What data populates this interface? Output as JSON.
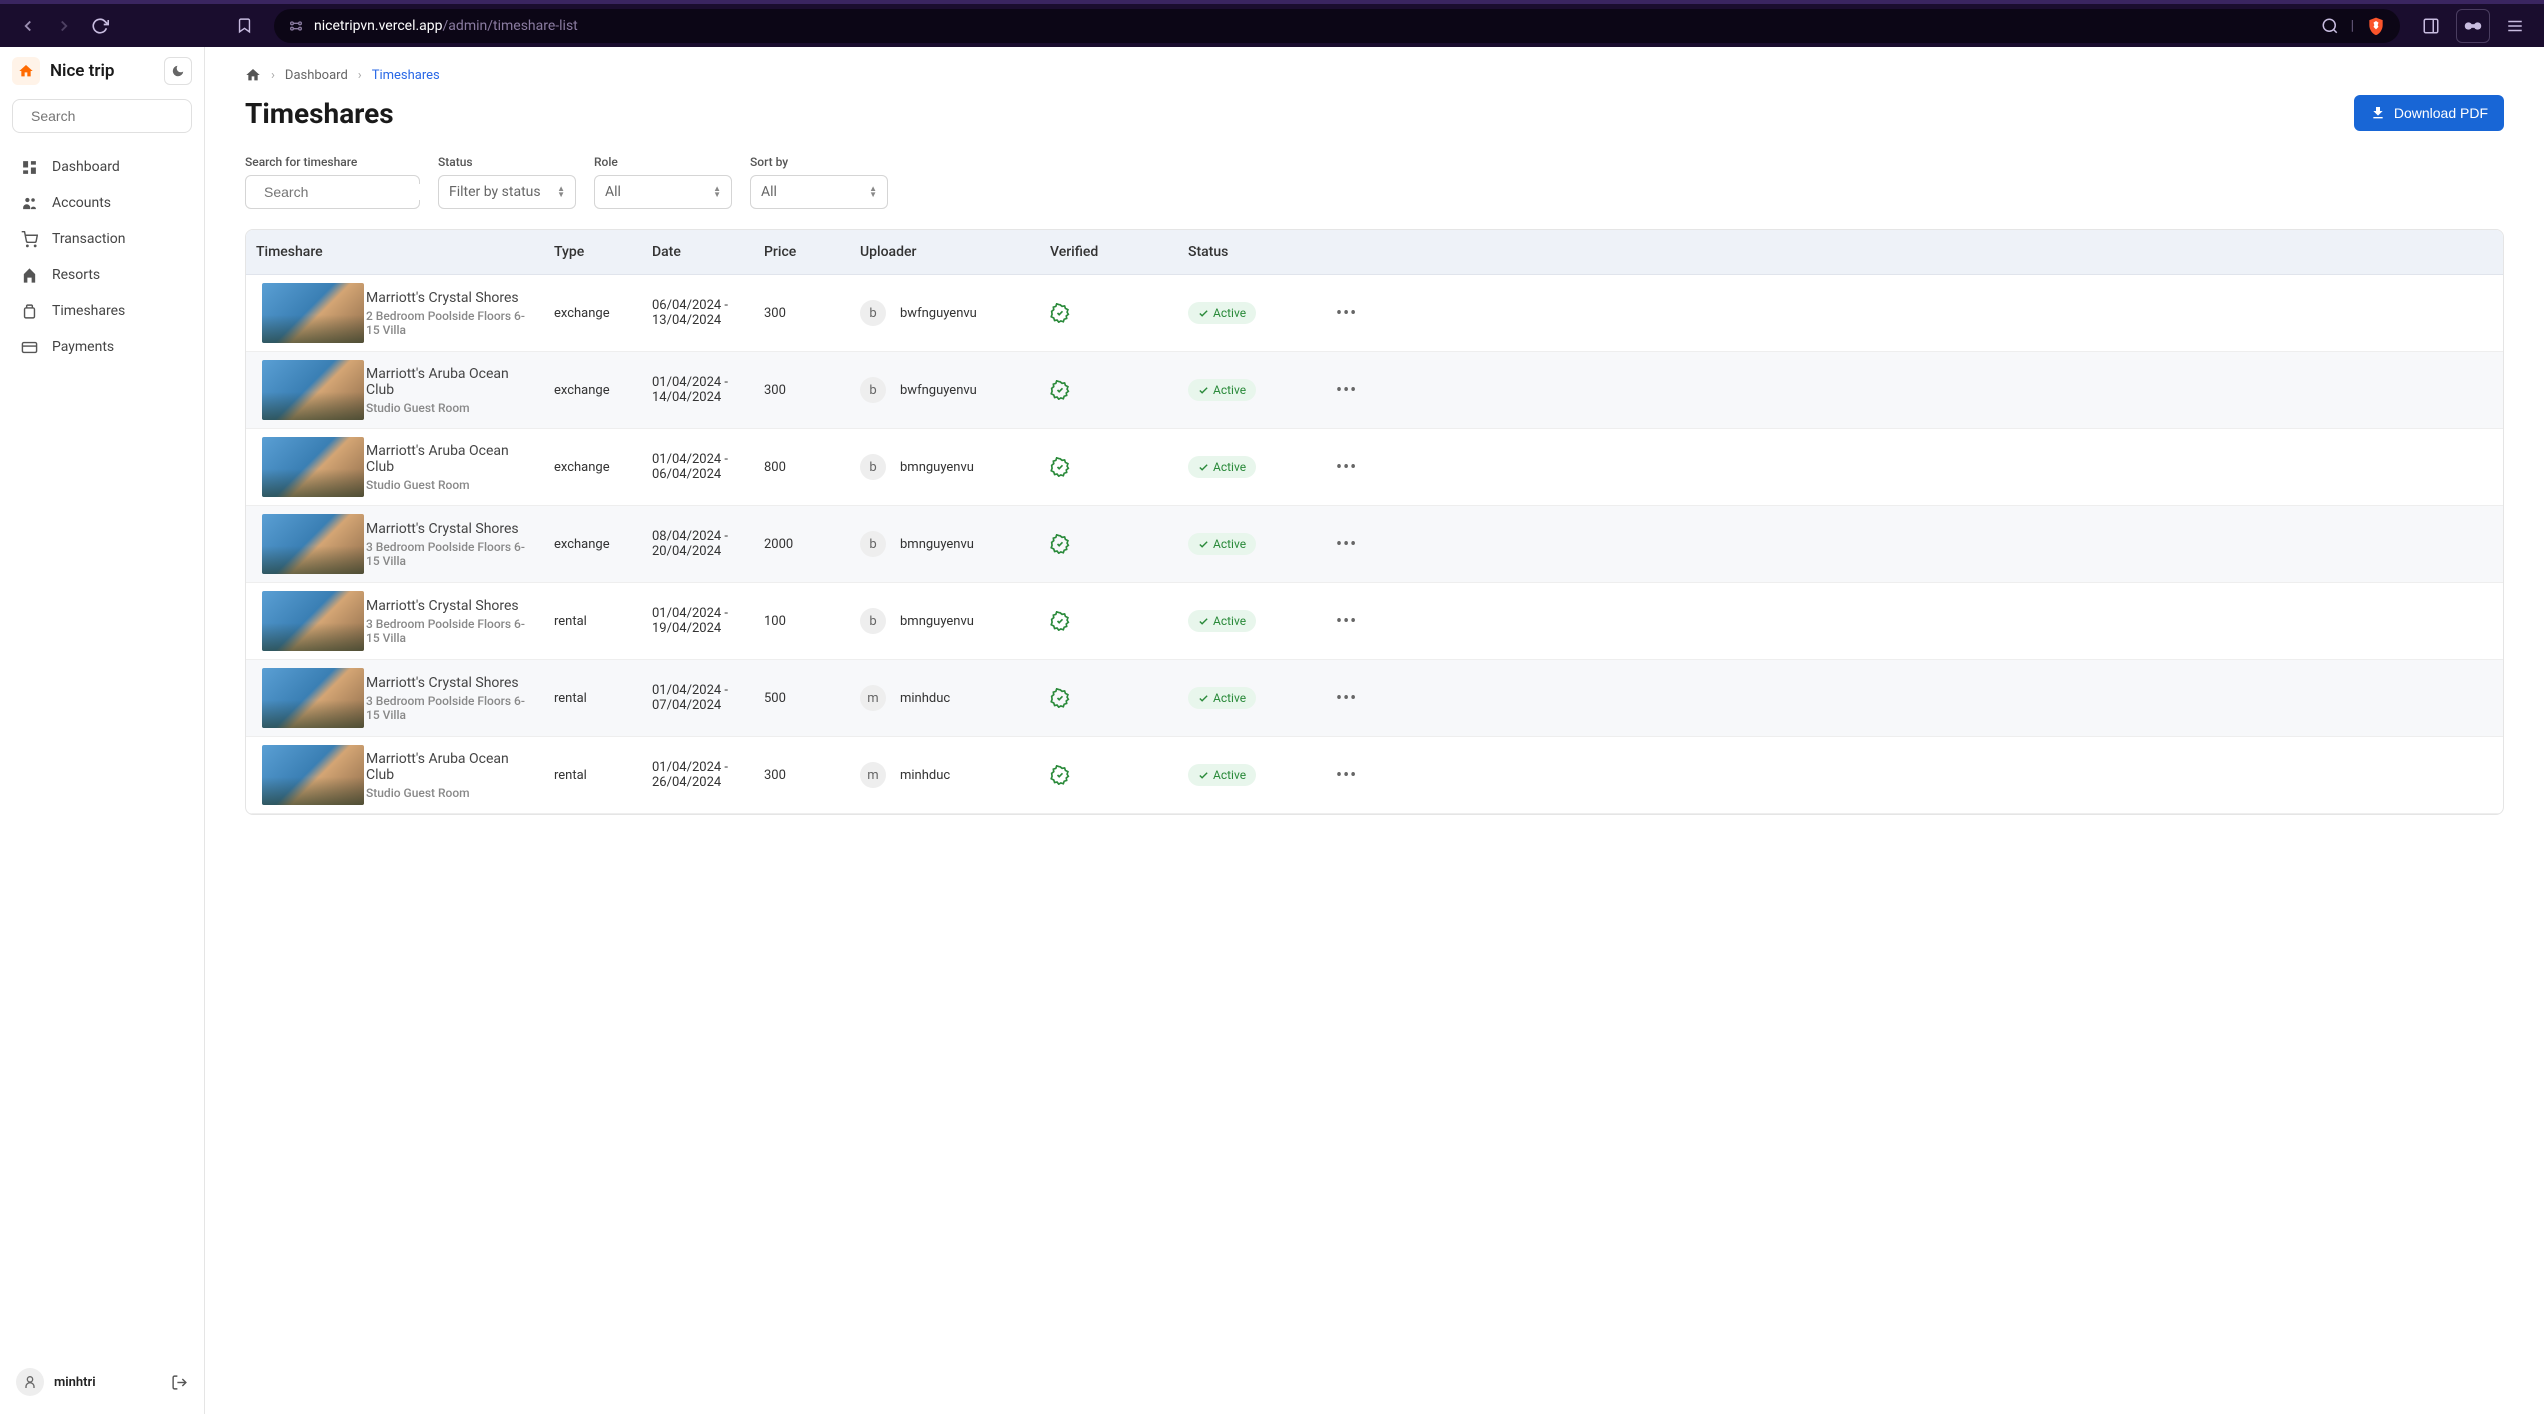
{
  "browser": {
    "url_host": "nicetripvn.vercel.app",
    "url_path": "/admin/timeshare-list"
  },
  "sidebar": {
    "brand": "Nice trip",
    "search_placeholder": "Search",
    "items": [
      {
        "icon": "dashboard",
        "label": "Dashboard"
      },
      {
        "icon": "accounts",
        "label": "Accounts"
      },
      {
        "icon": "transaction",
        "label": "Transaction"
      },
      {
        "icon": "resorts",
        "label": "Resorts"
      },
      {
        "icon": "timeshares",
        "label": "Timeshares"
      },
      {
        "icon": "payments",
        "label": "Payments"
      }
    ],
    "user": {
      "name": "minhtri",
      "avatar_letter": ""
    }
  },
  "breadcrumb": {
    "items": [
      {
        "label": "Dashboard",
        "current": false
      },
      {
        "label": "Timeshares",
        "current": true
      }
    ]
  },
  "page": {
    "title": "Timeshares",
    "download_label": "Download PDF"
  },
  "filters": {
    "search": {
      "label": "Search for timeshare",
      "placeholder": "Search"
    },
    "status": {
      "label": "Status",
      "placeholder": "Filter by status"
    },
    "role": {
      "label": "Role",
      "placeholder": "All"
    },
    "sort": {
      "label": "Sort by",
      "placeholder": "All"
    }
  },
  "table": {
    "columns": {
      "timeshare": "Timeshare",
      "type": "Type",
      "date": "Date",
      "price": "Price",
      "uploader": "Uploader",
      "verified": "Verified",
      "status": "Status"
    },
    "rows": [
      {
        "name": "Marriott's Crystal Shores",
        "sub": "2 Bedroom Poolside Floors 6-15 Villa",
        "type": "exchange",
        "date": "06/04/2024 - 13/04/2024",
        "price": "300",
        "uploader_initial": "b",
        "uploader": "bwfnguyenvu",
        "status": "Active"
      },
      {
        "name": "Marriott's Aruba Ocean Club",
        "sub": "Studio Guest Room",
        "type": "exchange",
        "date": "01/04/2024 - 14/04/2024",
        "price": "300",
        "uploader_initial": "b",
        "uploader": "bwfnguyenvu",
        "status": "Active"
      },
      {
        "name": "Marriott's Aruba Ocean Club",
        "sub": "Studio Guest Room",
        "type": "exchange",
        "date": "01/04/2024 - 06/04/2024",
        "price": "800",
        "uploader_initial": "b",
        "uploader": "bmnguyenvu",
        "status": "Active"
      },
      {
        "name": "Marriott's Crystal Shores",
        "sub": "3 Bedroom Poolside Floors 6-15 Villa",
        "type": "exchange",
        "date": "08/04/2024 - 20/04/2024",
        "price": "2000",
        "uploader_initial": "b",
        "uploader": "bmnguyenvu",
        "status": "Active"
      },
      {
        "name": "Marriott's Crystal Shores",
        "sub": "3 Bedroom Poolside Floors 6-15 Villa",
        "type": "rental",
        "date": "01/04/2024 - 19/04/2024",
        "price": "100",
        "uploader_initial": "b",
        "uploader": "bmnguyenvu",
        "status": "Active"
      },
      {
        "name": "Marriott's Crystal Shores",
        "sub": "3 Bedroom Poolside Floors 6-15 Villa",
        "type": "rental",
        "date": "01/04/2024 - 07/04/2024",
        "price": "500",
        "uploader_initial": "m",
        "uploader": "minhduc",
        "status": "Active"
      },
      {
        "name": "Marriott's Aruba Ocean Club",
        "sub": "Studio Guest Room",
        "type": "rental",
        "date": "01/04/2024 - 26/04/2024",
        "price": "300",
        "uploader_initial": "m",
        "uploader": "minhduc",
        "status": "Active"
      }
    ]
  }
}
